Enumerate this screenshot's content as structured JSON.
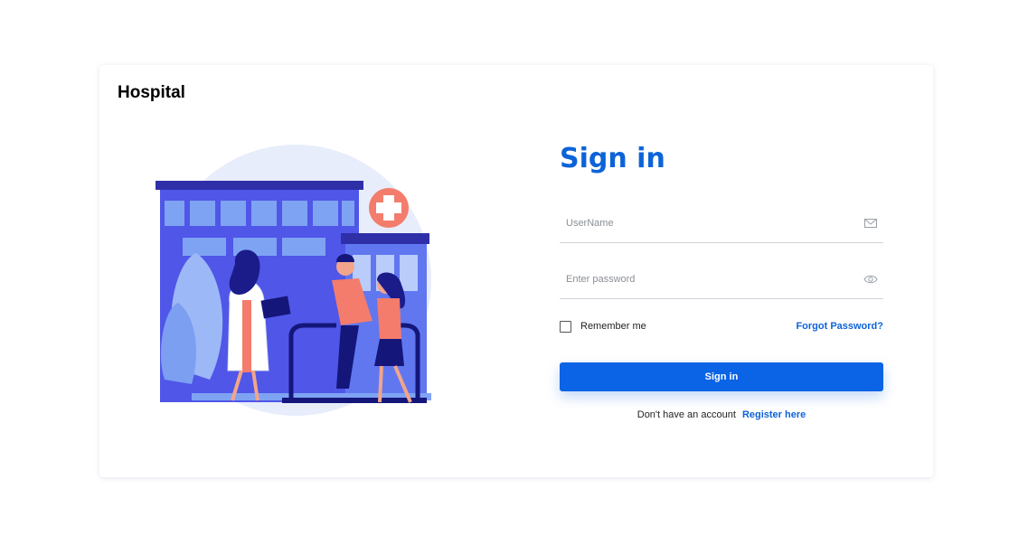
{
  "brand": {
    "name": "Hospital"
  },
  "illustration": {
    "subject": "hospital building with doctor and patients"
  },
  "form": {
    "title": "Sign in",
    "username": {
      "placeholder": "UserName",
      "value": "",
      "icon": "mail-icon"
    },
    "password": {
      "placeholder": "Enter password",
      "value": "",
      "icon": "eye-icon"
    },
    "remember_label": "Remember me",
    "remember_checked": false,
    "forgot_label": "Forgot Password?",
    "submit_label": "Sign in",
    "register_prompt": "Don't have an account",
    "register_link": "Register here"
  },
  "colors": {
    "accent": "#0d63d8",
    "button": "#0b63e5",
    "building": "#4f56e8",
    "cross": "#f37c6c"
  }
}
